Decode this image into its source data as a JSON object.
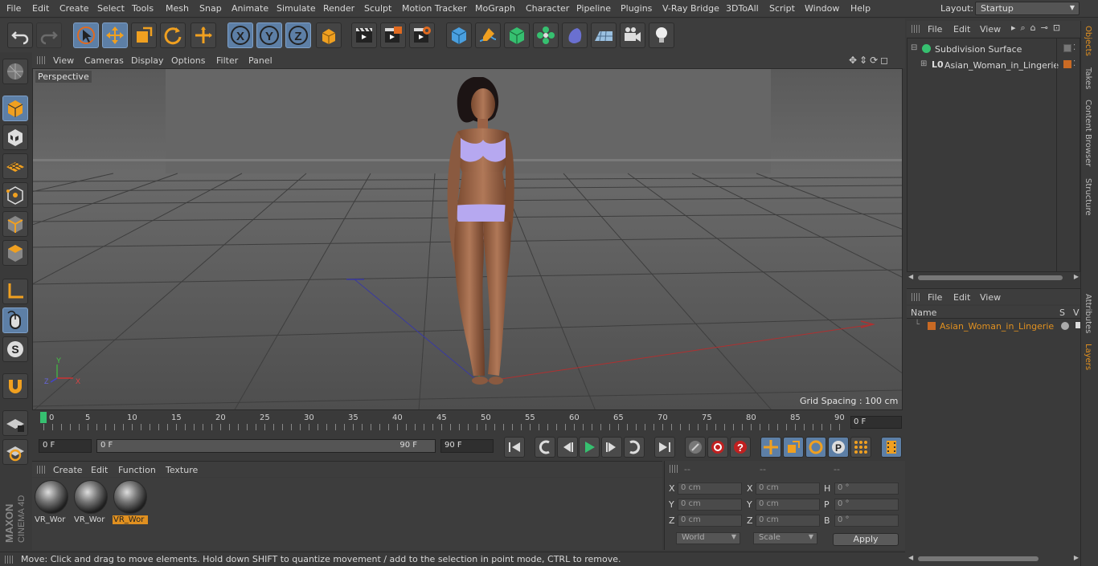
{
  "menu": [
    "File",
    "Edit",
    "Create",
    "Select",
    "Tools",
    "Mesh",
    "Snap",
    "Animate",
    "Simulate",
    "Render",
    "Sculpt",
    "Motion Tracker",
    "MoGraph",
    "Character",
    "Pipeline",
    "Plugins",
    "V-Ray Bridge",
    "3DToAll",
    "Script",
    "Window",
    "Help"
  ],
  "layout": {
    "label": "Layout:",
    "value": "Startup"
  },
  "toolbar": {
    "undo": "undo-icon",
    "redo": "redo-icon",
    "axis_x": "X",
    "axis_y": "Y",
    "axis_z": "Z"
  },
  "viewport": {
    "menu": [
      "View",
      "Cameras",
      "Display",
      "Options",
      "Filter",
      "Panel"
    ],
    "label": "Perspective",
    "grid_spacing": "Grid Spacing : 100 cm"
  },
  "timeline": {
    "ticks": [
      "0",
      "5",
      "10",
      "15",
      "20",
      "25",
      "30",
      "35",
      "40",
      "45",
      "50",
      "55",
      "60",
      "65",
      "70",
      "75",
      "80",
      "85",
      "90"
    ],
    "frame_end": "0 F",
    "start": "0 F",
    "range_start": "0 F",
    "range_end": "90 F",
    "end": "90 F"
  },
  "materials": {
    "menu": [
      "Create",
      "Edit",
      "Function",
      "Texture"
    ],
    "items": [
      {
        "label": "VR_Wor",
        "selected": false
      },
      {
        "label": "VR_Wor",
        "selected": false
      },
      {
        "label": "VR_Wor",
        "selected": true
      }
    ]
  },
  "coords": {
    "headers": [
      "--",
      "--",
      "--"
    ],
    "pos": [
      {
        "axis": "X",
        "value": "0 cm"
      },
      {
        "axis": "Y",
        "value": "0 cm"
      },
      {
        "axis": "Z",
        "value": "0 cm"
      }
    ],
    "size": [
      {
        "axis": "X",
        "value": "0 cm"
      },
      {
        "axis": "Y",
        "value": "0 cm"
      },
      {
        "axis": "Z",
        "value": "0 cm"
      }
    ],
    "rot": [
      {
        "axis": "H",
        "value": "0 °"
      },
      {
        "axis": "P",
        "value": "0 °"
      },
      {
        "axis": "B",
        "value": "0 °"
      }
    ],
    "world": "World",
    "scale": "Scale",
    "apply": "Apply"
  },
  "status": "Move: Click and drag to move elements. Hold down SHIFT to quantize movement / add to the selection in point mode, CTRL to remove.",
  "objects": {
    "menu": [
      "File",
      "Edit",
      "View"
    ],
    "items": [
      "Subdivision Surface",
      "Asian_Woman_in_Lingerie"
    ]
  },
  "layers": {
    "menu": [
      "File",
      "Edit",
      "View"
    ],
    "col_name": "Name",
    "col_s": "S",
    "col_v": "V",
    "items": [
      "Asian_Woman_in_Lingerie"
    ]
  },
  "sidetabs": [
    "Objects",
    "Takes",
    "Content Browser",
    "Structure",
    "Attributes",
    "Layers"
  ],
  "logo": "MAXON CINEMA 4D",
  "colors": {
    "accent": "#e09020",
    "select_blue": "#5d7fa6",
    "layer_orange": "#c96a24"
  }
}
